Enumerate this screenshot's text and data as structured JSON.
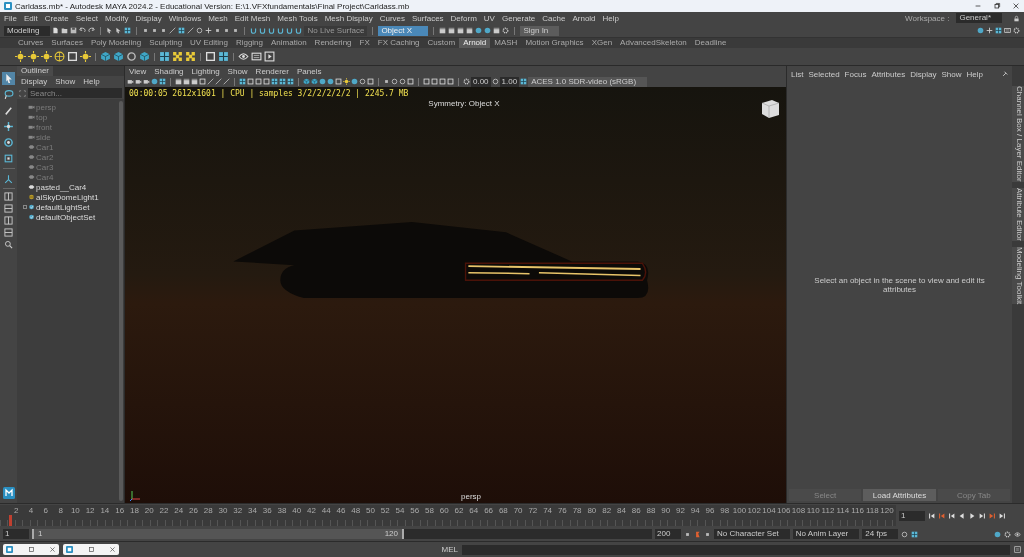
{
  "window": {
    "title": "Carldass.mb* - Autodesk MAYA 2024.2 - Educational Version: E:\\1.VFXfundamentals\\Final Project\\Carldass.mb"
  },
  "menu_bar": [
    "File",
    "Edit",
    "Create",
    "Select",
    "Modify",
    "Display",
    "Windows",
    "Mesh",
    "Edit Mesh",
    "Mesh Tools",
    "Mesh Display",
    "Curves",
    "Surfaces",
    "Deform",
    "UV",
    "Generate",
    "Cache",
    "Arnold",
    "Help"
  ],
  "status_line": {
    "mode": "Modeling",
    "live_surface": "No Live Surface",
    "symmetry": "Object X",
    "sign_in": "Sign In",
    "workspace_label": "Workspace :",
    "workspace": "General*"
  },
  "shelf_tabs": [
    {
      "label": "Curves",
      "selected": false
    },
    {
      "label": "Surfaces",
      "selected": false
    },
    {
      "label": "Poly Modeling",
      "selected": false
    },
    {
      "label": "Sculpting",
      "selected": false
    },
    {
      "label": "UV Editing",
      "selected": false
    },
    {
      "label": "Rigging",
      "selected": false
    },
    {
      "label": "Animation",
      "selected": false
    },
    {
      "label": "Rendering",
      "selected": false
    },
    {
      "label": "FX",
      "selected": false
    },
    {
      "label": "FX Caching",
      "selected": false
    },
    {
      "label": "Custom",
      "selected": false
    },
    {
      "label": "Arnold",
      "selected": true
    },
    {
      "label": "MASH",
      "selected": false
    },
    {
      "label": "Motion Graphics",
      "selected": false
    },
    {
      "label": "XGen",
      "selected": false
    },
    {
      "label": "AdvancedSkeleton",
      "selected": false
    },
    {
      "label": "Deadline",
      "selected": false
    }
  ],
  "toolbox": [
    {
      "kind": "select",
      "selected": true
    },
    {
      "kind": "lasso",
      "selected": false
    },
    {
      "kind": "paint",
      "selected": false
    },
    {
      "kind": "move",
      "selected": false
    },
    {
      "kind": "rotate",
      "selected": false
    },
    {
      "kind": "scale",
      "selected": false
    },
    {
      "kind": "axes",
      "selected": false
    }
  ],
  "outliner": {
    "tab": "Outliner",
    "menu": [
      "Display",
      "Show",
      "Help"
    ],
    "search_placeholder": "Search...",
    "items": [
      {
        "name": "persp",
        "kind": "camera",
        "hidden": true,
        "has_children": false
      },
      {
        "name": "top",
        "kind": "camera",
        "hidden": true,
        "has_children": false
      },
      {
        "name": "front",
        "kind": "camera",
        "hidden": true,
        "has_children": false
      },
      {
        "name": "side",
        "kind": "camera",
        "hidden": true,
        "has_children": false
      },
      {
        "name": "Car1",
        "kind": "mesh",
        "hidden": true,
        "has_children": false
      },
      {
        "name": "Car2",
        "kind": "mesh",
        "hidden": true,
        "has_children": false
      },
      {
        "name": "Car3",
        "kind": "mesh",
        "hidden": true,
        "has_children": false
      },
      {
        "name": "Car4",
        "kind": "mesh",
        "hidden": true,
        "has_children": false
      },
      {
        "name": "pasted__Car4",
        "kind": "mesh",
        "hidden": false,
        "has_children": false
      },
      {
        "name": "aiSkyDomeLight1",
        "kind": "light",
        "hidden": false,
        "has_children": false
      },
      {
        "name": "defaultLightSet",
        "kind": "set",
        "hidden": false,
        "has_children": true
      },
      {
        "name": "defaultObjectSet",
        "kind": "set",
        "hidden": false,
        "has_children": false
      }
    ]
  },
  "viewport": {
    "menu": [
      "View",
      "Shading",
      "Lighting",
      "Show",
      "Renderer",
      "Panels"
    ],
    "exposure": "0.00",
    "gamma": "1.00",
    "color_space": "ACES 1.0 SDR-video (sRGB)",
    "hud": "00:00:05 2612x1601 | CPU | samples 3/2/2/2/2/2 | 2245.7 MB",
    "symmetry": "Symmetry: Object X",
    "camera": "persp"
  },
  "attribute_editor": {
    "menu": [
      "List",
      "Selected",
      "Focus",
      "Attributes",
      "Display",
      "Show",
      "Help"
    ],
    "message": "Select an object in the scene to view and edit its attributes",
    "buttons": [
      {
        "label": "Select",
        "disabled": true
      },
      {
        "label": "Load Attributes",
        "disabled": false
      },
      {
        "label": "Copy Tab",
        "disabled": true
      }
    ]
  },
  "side_tabs": [
    "Channel Box / Layer Editor",
    "Attribute Editor",
    "Modeling Toolkit"
  ],
  "time_slider": {
    "ticks": [
      "2",
      "4",
      "6",
      "8",
      "10",
      "12",
      "14",
      "16",
      "18",
      "20",
      "22",
      "24",
      "26",
      "28",
      "30",
      "32",
      "34",
      "36",
      "38",
      "40",
      "42",
      "44",
      "46",
      "48",
      "50",
      "52",
      "54",
      "56",
      "58",
      "60",
      "62",
      "64",
      "66",
      "68",
      "70",
      "72",
      "74",
      "76",
      "78",
      "80",
      "82",
      "84",
      "86",
      "88",
      "90",
      "92",
      "94",
      "96",
      "98",
      "100",
      "102",
      "104",
      "106",
      "108",
      "110",
      "112",
      "114",
      "116",
      "118",
      "120"
    ],
    "current_frame": "1",
    "level": 0
  },
  "range_slider": {
    "start": "1",
    "range_start": "1",
    "range_end": "120",
    "end": "200",
    "level": 0.6,
    "character_set": "No Character Set",
    "anim_layer": "No Anim Layer",
    "fps": "24 fps"
  },
  "command_line": {
    "label": "MEL"
  },
  "minimized_windows": [
    {
      "kind": "window"
    },
    {
      "kind": "window"
    }
  ]
}
